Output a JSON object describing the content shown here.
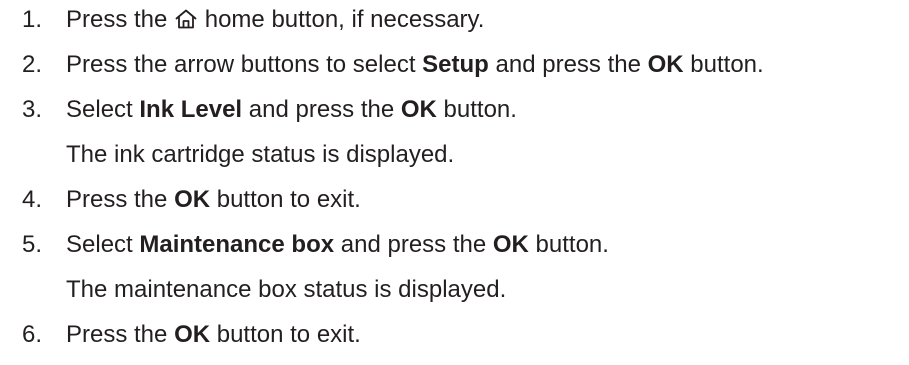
{
  "steps": [
    {
      "number": "1.",
      "before": "Press the",
      "icon": "home-icon",
      "after": "home button, if necessary."
    },
    {
      "number": "2.",
      "part1": "Press the arrow buttons to select",
      "bold1": "Setup",
      "part2": "and press the",
      "bold2": "OK",
      "part3": "button."
    },
    {
      "number": "3.",
      "part1": "Select",
      "bold1": "Ink Level",
      "part2": "and press the",
      "bold2": "OK",
      "part3": "button.",
      "note": "The ink cartridge status is displayed."
    },
    {
      "number": "4.",
      "part1": "Press the",
      "bold1": "OK",
      "part2": "button to exit."
    },
    {
      "number": "5.",
      "part1": "Select",
      "bold1": "Maintenance box",
      "part2": "and press the",
      "bold2": "OK",
      "part3": "button.",
      "note": "The maintenance box status is displayed."
    },
    {
      "number": "6.",
      "part1": "Press the",
      "bold1": "OK",
      "part2": "button to exit."
    }
  ]
}
